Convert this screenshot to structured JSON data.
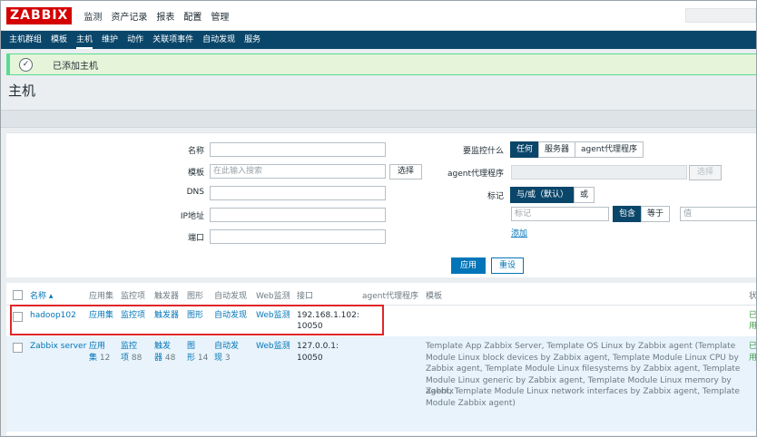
{
  "topbar": {
    "logo": "ZABBIX",
    "menu": [
      "监测",
      "资产记录",
      "报表",
      "配置",
      "管理"
    ],
    "active_menu": "配置"
  },
  "subnav": {
    "items": [
      "主机群组",
      "模板",
      "主机",
      "维护",
      "动作",
      "关联项事件",
      "自动发现",
      "服务"
    ],
    "active": "主机"
  },
  "message": {
    "text": "已添加主机",
    "icon": "check-icon"
  },
  "page_title": "主机",
  "filter": {
    "name_label": "名称",
    "template_label": "模板",
    "template_placeholder": "在此输入搜索",
    "template_select": "选择",
    "dns_label": "DNS",
    "ip_label": "IP地址",
    "port_label": "端口",
    "monitored_by_label": "要监控什么",
    "monitored_by_options": [
      "任何",
      "服务器",
      "agent代理程序"
    ],
    "monitored_by_selected": "任何",
    "proxy_label": "agent代理程序",
    "proxy_select": "选择",
    "tags_label": "标记",
    "tags_eval_options": [
      "与/或（默认）",
      "或"
    ],
    "tags_eval_selected": "与/或（默认）",
    "tag_placeholder": "标记",
    "tag_ops": [
      "包含",
      "等于"
    ],
    "tag_op_selected": "包含",
    "value_placeholder": "值",
    "add_link": "添加",
    "apply_button": "应用",
    "reset_button": "重设"
  },
  "table": {
    "headers": {
      "name": "名称 ▴",
      "applications": "应用集",
      "items": "监控项",
      "triggers": "触发器",
      "graphs": "图形",
      "discovery": "自动发现",
      "web": "Web监测",
      "interface": "接口",
      "proxy": "agent代理程序",
      "templates": "模板",
      "status": "状"
    },
    "rows": [
      {
        "name": "hadoop102",
        "applications": "应用集",
        "items": "监控项",
        "triggers": "触发器",
        "graphs": "图形",
        "discovery": "自动发现",
        "web": "Web监测",
        "interface_line1": "192.168.1.102:",
        "interface_line2": "10050",
        "templates": "",
        "status_line1": "已",
        "status_line2": "用"
      },
      {
        "name": "Zabbix server",
        "applications_l1": "应用",
        "applications_l2": "集",
        "applications_count": "12",
        "items_l1": "监控",
        "items_l2": "项",
        "items_count": "88",
        "triggers_l1": "触发",
        "triggers_l2": "器",
        "triggers_count": "48",
        "graphs_l1": "图",
        "graphs_l2": "形",
        "graphs_count": "14",
        "discovery_l1": "自动发",
        "discovery_l2": "现",
        "discovery_count": "3",
        "web": "Web监测",
        "interface_line1": "127.0.0.1:",
        "interface_line2": "10050",
        "templates_lines": [
          "Template App Zabbix Server, Template OS Linux by Zabbix agent (Template",
          "Module Linux block devices by Zabbix agent, Template Module Linux CPU by",
          "Zabbix agent, Template Module Linux filesystems by Zabbix agent, Template",
          "Module Linux generic by Zabbix agent, Template Module Linux memory by Zabbix",
          "agent, Template Module Linux network interfaces by Zabbix agent, Template",
          "Module Zabbix agent)"
        ],
        "status_line1": "已",
        "status_line2": "用"
      }
    ]
  },
  "colors": {
    "brand": "#d40000",
    "nav": "#0a466a",
    "link": "#0275b8",
    "success_bg": "#e6f4da",
    "highlight_box": "#e0262a"
  }
}
